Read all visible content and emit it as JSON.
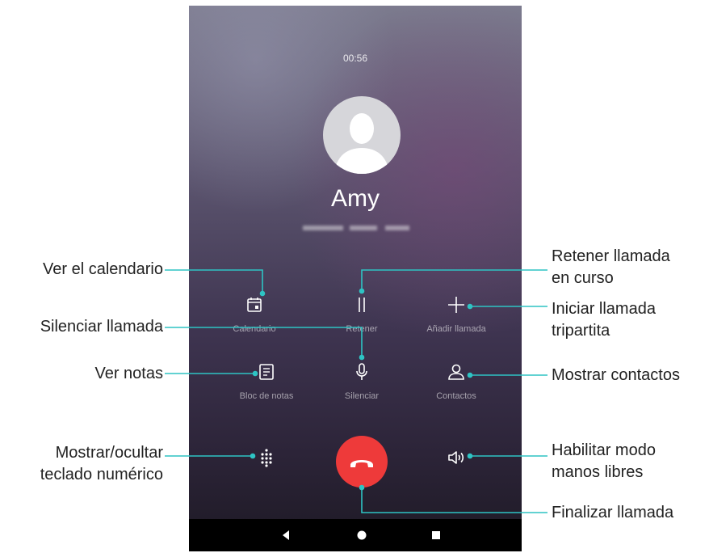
{
  "call": {
    "timer": "00:56",
    "contact_name": "Amy",
    "number_hidden": true
  },
  "controls": {
    "calendar": {
      "label": "Calendario",
      "icon": "calendar-icon"
    },
    "hold": {
      "label": "Retener",
      "icon": "pause-icon"
    },
    "add_call": {
      "label": "Añadir llamada",
      "icon": "plus-icon"
    },
    "notes": {
      "label": "Bloc de notas",
      "icon": "notepad-icon"
    },
    "mute": {
      "label": "Silenciar",
      "icon": "microphone-icon"
    },
    "contacts": {
      "label": "Contactos",
      "icon": "person-icon"
    },
    "dialpad": {
      "icon": "dialpad-icon"
    },
    "end_call": {
      "icon": "hang-up-icon",
      "color": "#ee3a3a"
    },
    "speaker": {
      "icon": "speaker-icon"
    }
  },
  "nav": {
    "back": "back-icon",
    "home": "home-icon",
    "recents": "recents-icon"
  },
  "callouts": {
    "calendar": "Ver el calendario",
    "mute": "Silenciar llamada",
    "notes": "Ver notas",
    "dialpad_1": "Mostrar/ocultar",
    "dialpad_2": "teclado numérico",
    "hold_1": "Retener llamada",
    "hold_2": "en curso",
    "add_1": "Iniciar llamada",
    "add_2": "tripartita",
    "contacts": "Mostrar contactos",
    "speaker_1": "Habilitar modo",
    "speaker_2": "manos libres",
    "end": "Finalizar llamada"
  },
  "colors": {
    "callout_line": "#2ec4c4",
    "end_call": "#ee3a3a"
  }
}
